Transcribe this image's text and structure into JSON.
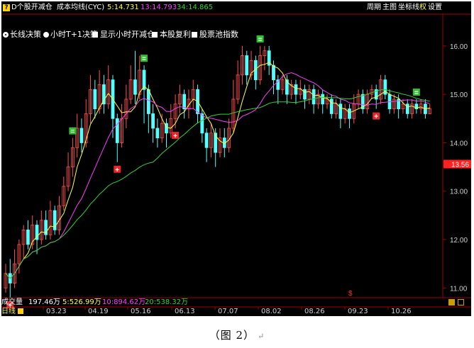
{
  "top_bar": {
    "app_title": "D个股开减仓",
    "indicator_name": "成本均线(CYC)",
    "ma5": "5:14.731",
    "ma13": "13:14.793",
    "ma34": "34:14.865",
    "menu": [
      "周期",
      "主图",
      "坐标线",
      "权",
      "设置"
    ]
  },
  "toolbar": {
    "long_decision": "长线决策",
    "hour_decision": "小时T+1决策",
    "show_hour_reduce": "显示小时开减仓",
    "compound_profit": "本股复利",
    "pool_index": "股票池指数"
  },
  "price_axis": {
    "ticks": [
      "16.00",
      "15.00",
      "14.00",
      "13.00",
      "12.00",
      "11.00"
    ],
    "current_price": "13.56"
  },
  "volume_bar": {
    "label": "成交量",
    "total": "197.46万",
    "ma5": "5:526.99万",
    "ma10": "10:894.62万",
    "ma20": "20:538.32万"
  },
  "date_axis": {
    "period": "日线",
    "dates": [
      "03.23",
      "04.19",
      "05.16",
      "06.13",
      "07.07",
      "08.02",
      "08.26",
      "09.23",
      "10.26"
    ]
  },
  "markers": {
    "buy": "+",
    "sell": "=",
    "dollar": "$"
  },
  "caption": "（图 2）",
  "colors": {
    "up": "#ff5050",
    "down": "#54ffff",
    "ma5_line": "#ffff3c",
    "ma13_line": "#ff3cff",
    "ma34_line": "#32d232",
    "axis_red": "#a00000",
    "price_badge": "#ff2020",
    "buy_marker": "#e8262a",
    "sell_marker": "#2fbf2f"
  },
  "chart_data": {
    "type": "candlestick",
    "price_range": [
      10.8,
      16.1
    ],
    "candles": [
      [
        11.0,
        11.3,
        10.9,
        11.5
      ],
      [
        11.3,
        11.1,
        10.8,
        11.6
      ],
      [
        11.1,
        11.5,
        11.0,
        11.8
      ],
      [
        11.5,
        11.9,
        11.3,
        12.0
      ],
      [
        11.9,
        12.2,
        11.6,
        12.3
      ],
      [
        12.2,
        11.9,
        11.8,
        12.4
      ],
      [
        11.9,
        12.3,
        11.8,
        12.5
      ],
      [
        12.3,
        12.0,
        11.7,
        12.4
      ],
      [
        12.0,
        12.4,
        11.9,
        12.6
      ],
      [
        12.4,
        12.1,
        12.0,
        12.6
      ],
      [
        12.1,
        12.6,
        12.0,
        12.8
      ],
      [
        12.6,
        12.2,
        12.1,
        12.7
      ],
      [
        12.2,
        12.7,
        12.1,
        12.9
      ],
      [
        12.7,
        13.1,
        12.6,
        13.3
      ],
      [
        13.1,
        13.5,
        13.0,
        13.8
      ],
      [
        13.5,
        13.9,
        13.3,
        14.1
      ],
      [
        13.9,
        14.3,
        13.7,
        14.6
      ],
      [
        14.3,
        14.0,
        13.8,
        14.5
      ],
      [
        14.0,
        14.6,
        13.9,
        14.9
      ],
      [
        14.6,
        15.1,
        14.4,
        15.4
      ],
      [
        15.1,
        14.7,
        14.5,
        15.3
      ],
      [
        14.7,
        15.2,
        14.6,
        15.5
      ],
      [
        15.2,
        14.8,
        14.6,
        15.4
      ],
      [
        14.8,
        15.3,
        14.7,
        15.6
      ],
      [
        15.3,
        14.5,
        14.1,
        15.4
      ],
      [
        14.5,
        14.0,
        13.6,
        14.6
      ],
      [
        14.0,
        14.5,
        13.9,
        14.8
      ],
      [
        14.5,
        14.9,
        14.3,
        15.2
      ],
      [
        14.9,
        15.3,
        14.8,
        15.6
      ],
      [
        15.3,
        15.0,
        14.8,
        15.9
      ],
      [
        15.0,
        15.5,
        14.9,
        15.8
      ],
      [
        15.5,
        15.1,
        14.4,
        15.6
      ],
      [
        15.1,
        14.6,
        14.2,
        15.2
      ],
      [
        14.6,
        14.3,
        14.0,
        14.8
      ],
      [
        14.3,
        14.1,
        13.9,
        14.5
      ],
      [
        14.1,
        14.4,
        14.0,
        14.6
      ],
      [
        14.4,
        14.2,
        13.9,
        14.5
      ],
      [
        14.2,
        14.5,
        14.1,
        14.8
      ],
      [
        14.5,
        14.8,
        14.3,
        15.0
      ],
      [
        14.8,
        15.0,
        14.6,
        15.2
      ],
      [
        15.0,
        14.7,
        14.5,
        15.1
      ],
      [
        14.7,
        14.9,
        14.5,
        15.1
      ],
      [
        14.9,
        15.1,
        14.7,
        15.3
      ],
      [
        15.1,
        14.6,
        14.4,
        15.2
      ],
      [
        14.6,
        14.2,
        14.0,
        14.7
      ],
      [
        14.2,
        13.9,
        13.6,
        14.3
      ],
      [
        13.9,
        14.2,
        13.7,
        14.4
      ],
      [
        14.2,
        13.8,
        13.5,
        14.3
      ],
      [
        13.8,
        14.1,
        13.7,
        14.3
      ],
      [
        14.1,
        13.9,
        13.7,
        14.3
      ],
      [
        13.9,
        14.3,
        13.8,
        14.5
      ],
      [
        14.3,
        14.9,
        14.2,
        15.3
      ],
      [
        14.9,
        15.4,
        14.8,
        15.7
      ],
      [
        15.4,
        15.8,
        15.2,
        16.0
      ],
      [
        15.8,
        15.4,
        15.2,
        15.9
      ],
      [
        15.4,
        15.7,
        15.3,
        15.9
      ],
      [
        15.7,
        15.3,
        15.1,
        15.8
      ],
      [
        15.3,
        15.8,
        15.2,
        16.0
      ],
      [
        15.8,
        15.9,
        15.5,
        16.0
      ],
      [
        15.9,
        15.6,
        15.4,
        16.0
      ],
      [
        15.6,
        15.3,
        15.0,
        15.7
      ],
      [
        15.3,
        15.1,
        14.8,
        15.4
      ],
      [
        15.1,
        15.3,
        15.0,
        15.4
      ],
      [
        15.3,
        15.0,
        14.8,
        15.4
      ],
      [
        15.0,
        15.2,
        14.9,
        15.3
      ],
      [
        15.2,
        15.0,
        14.8,
        15.3
      ],
      [
        15.0,
        15.1,
        14.9,
        15.3
      ],
      [
        15.1,
        14.9,
        14.7,
        15.2
      ],
      [
        14.9,
        15.1,
        14.8,
        15.2
      ],
      [
        15.1,
        14.8,
        14.6,
        15.2
      ],
      [
        14.8,
        15.0,
        14.7,
        15.1
      ],
      [
        15.0,
        14.8,
        14.6,
        15.1
      ],
      [
        14.8,
        14.9,
        14.7,
        15.0
      ],
      [
        14.9,
        14.6,
        14.5,
        15.0
      ],
      [
        14.6,
        14.8,
        14.5,
        14.9
      ],
      [
        14.8,
        14.5,
        14.3,
        14.9
      ],
      [
        14.5,
        14.7,
        14.4,
        14.8
      ],
      [
        14.7,
        14.5,
        14.3,
        14.8
      ],
      [
        14.5,
        14.8,
        14.4,
        15.0
      ],
      [
        14.8,
        15.0,
        14.7,
        15.1
      ],
      [
        15.0,
        14.7,
        14.6,
        15.1
      ],
      [
        14.7,
        15.0,
        14.6,
        15.1
      ],
      [
        15.0,
        15.1,
        14.9,
        15.2
      ],
      [
        15.1,
        14.9,
        14.7,
        15.2
      ],
      [
        14.9,
        15.3,
        14.8,
        15.4
      ],
      [
        15.3,
        15.0,
        14.9,
        15.4
      ],
      [
        15.0,
        14.7,
        14.6,
        15.1
      ],
      [
        14.7,
        14.9,
        14.6,
        15.0
      ],
      [
        14.9,
        14.7,
        14.5,
        15.0
      ],
      [
        14.7,
        14.8,
        14.6,
        14.9
      ],
      [
        14.8,
        14.6,
        14.5,
        14.9
      ],
      [
        14.6,
        14.8,
        14.5,
        14.9
      ],
      [
        14.8,
        14.7,
        14.6,
        14.9
      ],
      [
        14.7,
        14.8,
        14.6,
        14.9
      ],
      [
        14.8,
        14.6,
        14.5,
        14.9
      ],
      [
        14.6,
        14.7,
        14.6,
        14.8
      ]
    ],
    "buy_signal_indices": [
      1,
      25,
      38,
      83
    ],
    "sell_signal_indices": [
      15,
      31,
      57,
      92
    ]
  }
}
